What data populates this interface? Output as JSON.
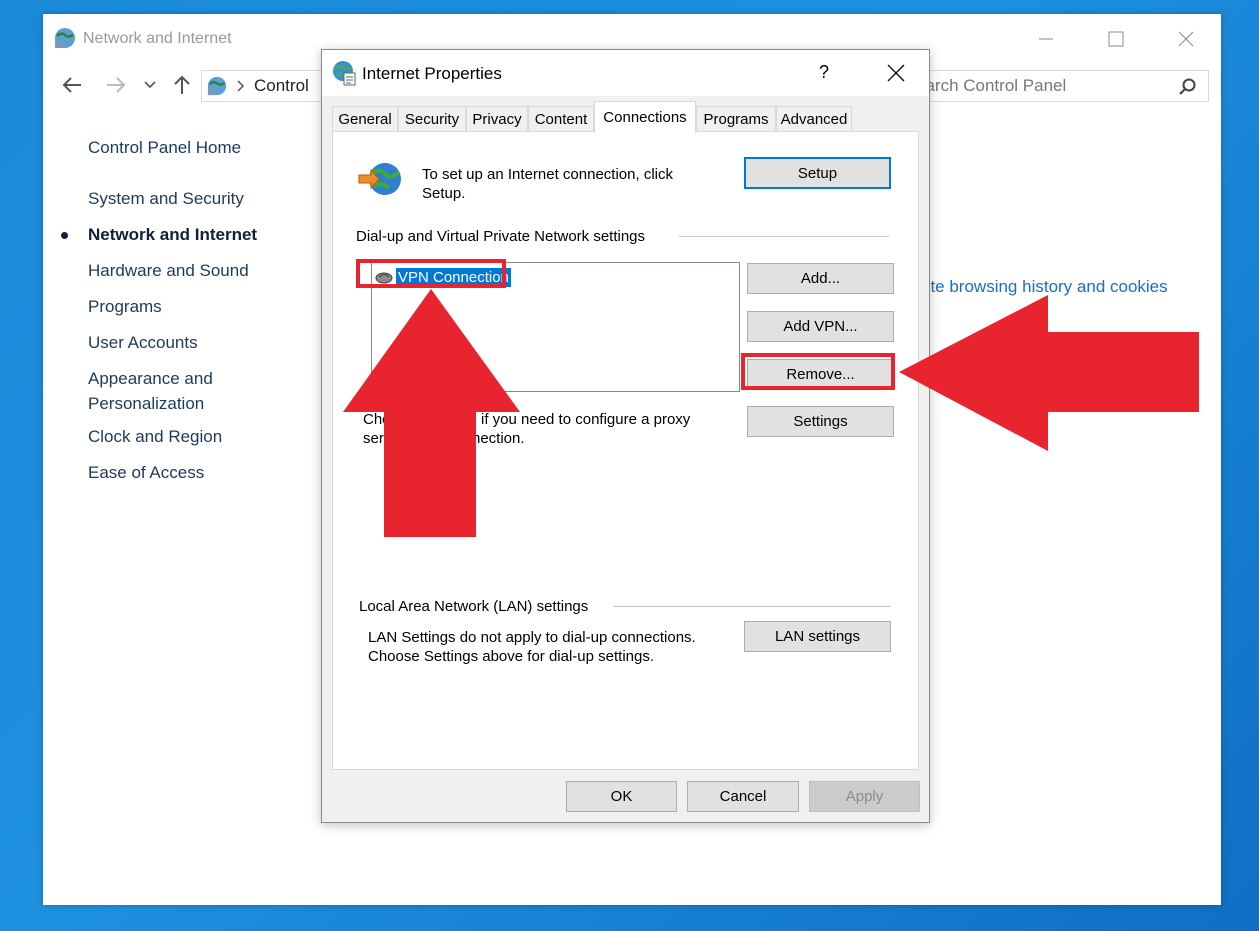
{
  "control_panel": {
    "title": "Network and Internet",
    "address": "Control",
    "search_placeholder": "earch Control Panel",
    "sidebar": [
      {
        "label": "Control Panel Home"
      },
      {
        "label": "System and Security"
      },
      {
        "label": "Network and Internet",
        "current": true
      },
      {
        "label": "Hardware and Sound"
      },
      {
        "label": "Programs"
      },
      {
        "label": "User Accounts"
      },
      {
        "label": "Appearance and"
      },
      {
        "label": "Personalization"
      },
      {
        "label": "Clock and Region"
      },
      {
        "label": "Ease of Access"
      }
    ],
    "link": "ete browsing history and cookies"
  },
  "dialog": {
    "title": "Internet Properties",
    "help": "?",
    "tabs": [
      "General",
      "Security",
      "Privacy",
      "Content",
      "Connections",
      "Programs",
      "Advanced"
    ],
    "active_tab": "Connections",
    "setup_text_1": "To set up an Internet connection, click",
    "setup_text_2": "Setup.",
    "setup_button": "Setup",
    "dialup_header": "Dial-up and Virtual Private Network settings",
    "vpn_item": "VPN Connection",
    "add_button": "Add...",
    "add_vpn_button": "Add VPN...",
    "remove_button": "Remove...",
    "settings_button": "Settings",
    "proxy_text_1a": "Cho",
    "proxy_text_1b": "if you need to configure a proxy",
    "proxy_text_2a": "ser",
    "proxy_text_2b": "nection.",
    "lan_header": "Local Area Network (LAN) settings",
    "lan_text_1": "LAN Settings do not apply to dial-up connections.",
    "lan_text_2": "Choose Settings above for dial-up settings.",
    "lan_button": "LAN settings",
    "ok_button": "OK",
    "cancel_button": "Cancel",
    "apply_button": "Apply"
  },
  "colors": {
    "desktop": "#1a8ad8",
    "highlight": "#e8242e",
    "selection": "#0078d7",
    "link": "#1a6ec8"
  }
}
